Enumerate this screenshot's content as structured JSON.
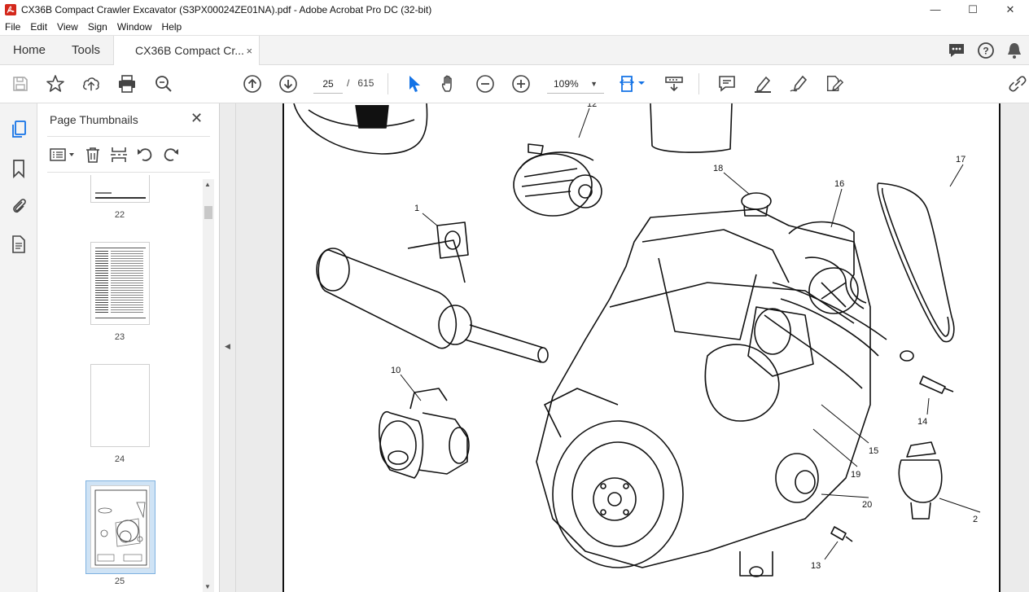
{
  "window": {
    "title": "CX36B Compact Crawler Excavator (S3PX00024ZE01NA).pdf - Adobe Acrobat Pro DC (32-bit)",
    "controls": [
      "—",
      "☐",
      "✕"
    ]
  },
  "menu": [
    "File",
    "Edit",
    "View",
    "Sign",
    "Window",
    "Help"
  ],
  "tabs": {
    "home": "Home",
    "tools": "Tools",
    "document": "CX36B Compact Cr...",
    "close": "×"
  },
  "toolbar": {
    "page_current": "25",
    "page_separator": "/",
    "page_total": "615",
    "zoom": "109%"
  },
  "panel": {
    "title": "Page Thumbnails",
    "close": "✕",
    "thumbnails": [
      {
        "label": "22"
      },
      {
        "label": "23"
      },
      {
        "label": "24"
      },
      {
        "label": "25",
        "selected": true
      }
    ]
  },
  "diagram": {
    "callouts": [
      "12",
      "18",
      "16",
      "17",
      "1",
      "10",
      "14",
      "15",
      "19",
      "20",
      "2",
      "13"
    ]
  },
  "colors": {
    "accent": "#1473e6",
    "chrome_bg": "#f3f3f3",
    "selected_thumb_bg": "#cfe3f5",
    "doc_bg": "#ebebeb"
  }
}
